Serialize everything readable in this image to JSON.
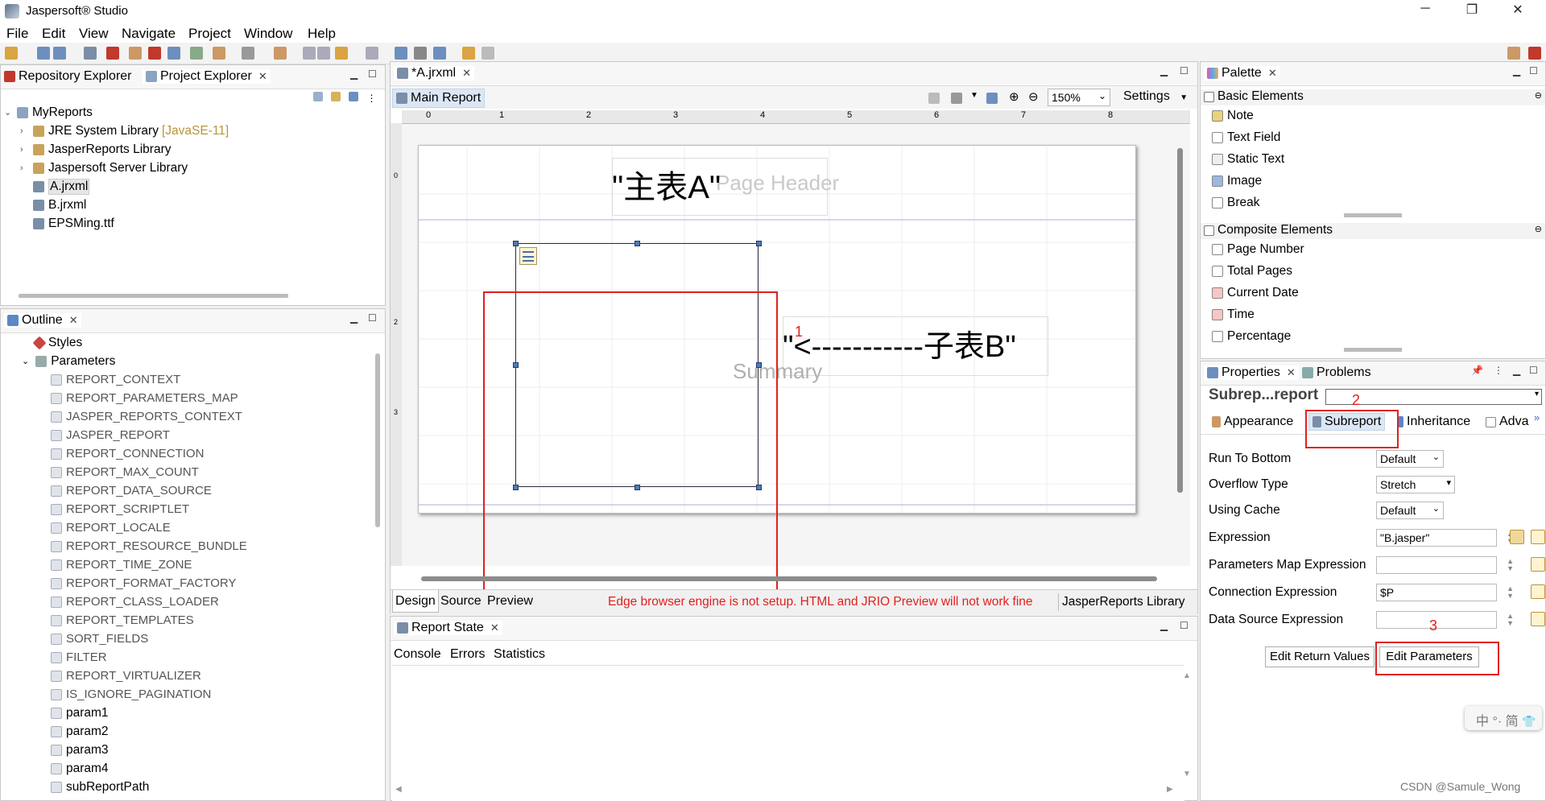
{
  "window": {
    "title": "Jaspersoft® Studio"
  },
  "menu": [
    "File",
    "Edit",
    "View",
    "Navigate",
    "Project",
    "Window",
    "Help"
  ],
  "left_top": {
    "tabs": [
      "Repository Explorer",
      "Project Explorer"
    ],
    "tree": [
      {
        "label": "MyReports",
        "indent": 0,
        "expanded": true
      },
      {
        "label": "JRE System Library",
        "suffix": "[JavaSE-11]",
        "indent": 1
      },
      {
        "label": "JasperReports Library",
        "indent": 1
      },
      {
        "label": "Jaspersoft Server Library",
        "indent": 1
      },
      {
        "label": "A.jrxml",
        "indent": 1,
        "selected": true
      },
      {
        "label": "B.jrxml",
        "indent": 1
      },
      {
        "label": "EPSMing.ttf",
        "indent": 1
      }
    ]
  },
  "outline": {
    "tab": "Outline",
    "styles": "Styles",
    "parameters": "Parameters",
    "params": [
      "REPORT_CONTEXT",
      "REPORT_PARAMETERS_MAP",
      "JASPER_REPORTS_CONTEXT",
      "JASPER_REPORT",
      "REPORT_CONNECTION",
      "REPORT_MAX_COUNT",
      "REPORT_DATA_SOURCE",
      "REPORT_SCRIPTLET",
      "REPORT_LOCALE",
      "REPORT_RESOURCE_BUNDLE",
      "REPORT_TIME_ZONE",
      "REPORT_FORMAT_FACTORY",
      "REPORT_CLASS_LOADER",
      "REPORT_TEMPLATES",
      "SORT_FIELDS",
      "FILTER",
      "REPORT_VIRTUALIZER",
      "IS_IGNORE_PAGINATION",
      "param1",
      "param2",
      "param3",
      "param4",
      "subReportPath"
    ]
  },
  "editor": {
    "file_tab": "*A.jrxml",
    "sub_tab": "Main Report",
    "zoom": "150%",
    "settings": "Settings",
    "ruler_marks": [
      "0",
      "1",
      "2",
      "3",
      "4",
      "5",
      "6",
      "7",
      "8"
    ],
    "page_header_text": "\"主表A\"",
    "page_header_label": "Page Header",
    "subreport_text": "\"<-----------子表B\"",
    "summary_label": "Summary",
    "annotation1": "1",
    "bottom_tabs": [
      "Design",
      "Source",
      "Preview"
    ],
    "warning": "Edge browser engine is not setup. HTML and JRIO Preview will not work fine",
    "jr_library": "JasperReports Library"
  },
  "report_state": {
    "tab": "Report State",
    "subtabs": [
      "Console",
      "Errors",
      "Statistics"
    ]
  },
  "palette": {
    "tab": "Palette",
    "basic_header": "Basic Elements",
    "basic": [
      "Note",
      "Text Field",
      "Static Text",
      "Image",
      "Break"
    ],
    "composite_header": "Composite Elements",
    "composite": [
      "Page Number",
      "Total Pages",
      "Current Date",
      "Time",
      "Percentage"
    ]
  },
  "properties": {
    "tabs": [
      "Properties",
      "Problems"
    ],
    "title": "Subrep...report",
    "annotation2": "2",
    "subtabs": [
      "Appearance",
      "Subreport",
      "Inheritance",
      "Adva"
    ],
    "rows": [
      {
        "label": "Run To Bottom",
        "value": "Default"
      },
      {
        "label": "Overflow Type",
        "value": "Stretch"
      },
      {
        "label": "Using Cache",
        "value": "Default"
      },
      {
        "label": "Expression",
        "value": "\"B.jasper\""
      },
      {
        "label": "Parameters Map Expression",
        "value": ""
      },
      {
        "label": "Connection Expression",
        "value": "$P"
      },
      {
        "label": "Data Source Expression",
        "value": ""
      }
    ],
    "annotation3": "3",
    "edit_return": "Edit Return Values",
    "edit_params": "Edit Parameters"
  },
  "ime": "中 °· 简",
  "watermark": "CSDN @Samule_Wong"
}
